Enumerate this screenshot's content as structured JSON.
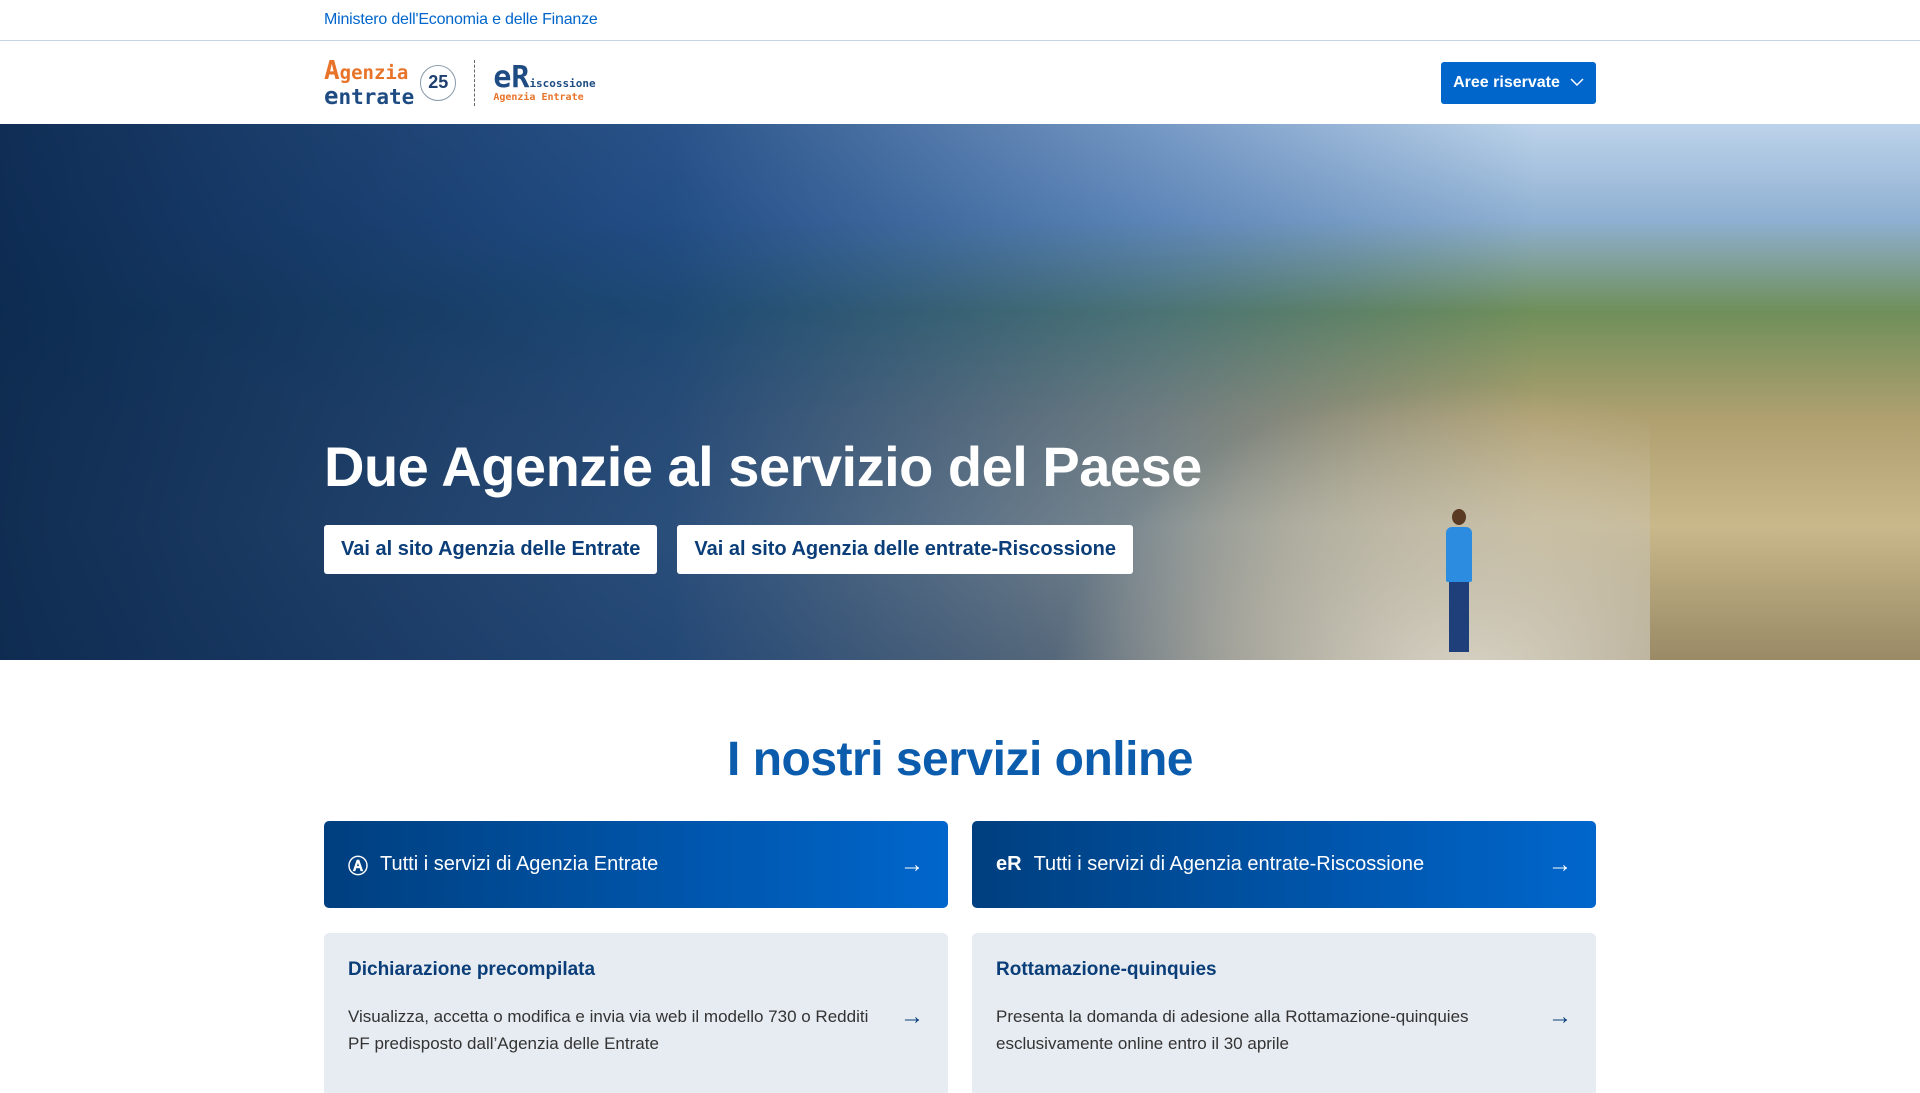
{
  "topbar": {
    "ministry": "Ministero dell'Economia e delle Finanze"
  },
  "header": {
    "logo_ae": {
      "line1": "genzia",
      "line2": "ntrate",
      "badge": "25"
    },
    "logo_ar": {
      "line1": "iscossione",
      "line2": "Agenzia Entrate"
    },
    "reserved_button": "Aree riservate"
  },
  "hero": {
    "title": "Due Agenzie al servizio del Paese",
    "buttons": [
      "Vai al sito Agenzia delle Entrate",
      "Vai al sito Agenzia delle entrate-Riscossione"
    ],
    "slides": 4,
    "active_slide": 1
  },
  "services": {
    "title": "I nostri servizi online",
    "main": [
      {
        "icon": "agenzia-entrate-icon",
        "label": "Tutti i servizi di Agenzia Entrate"
      },
      {
        "icon": "riscossione-icon",
        "label": "Tutti i servizi di Agenzia entrate-Riscossione"
      }
    ],
    "cards": [
      {
        "title": "Dichiarazione precompilata",
        "body": "Visualizza, accetta o modifica e invia via web il modello 730 o Redditi PF predisposto dall’Agenzia delle Entrate"
      },
      {
        "title": "Rottamazione-quinquies",
        "body": "Presenta la domanda di adesione alla Rottamazione-quinquies esclusivamente online entro il 30 aprile"
      }
    ]
  }
}
